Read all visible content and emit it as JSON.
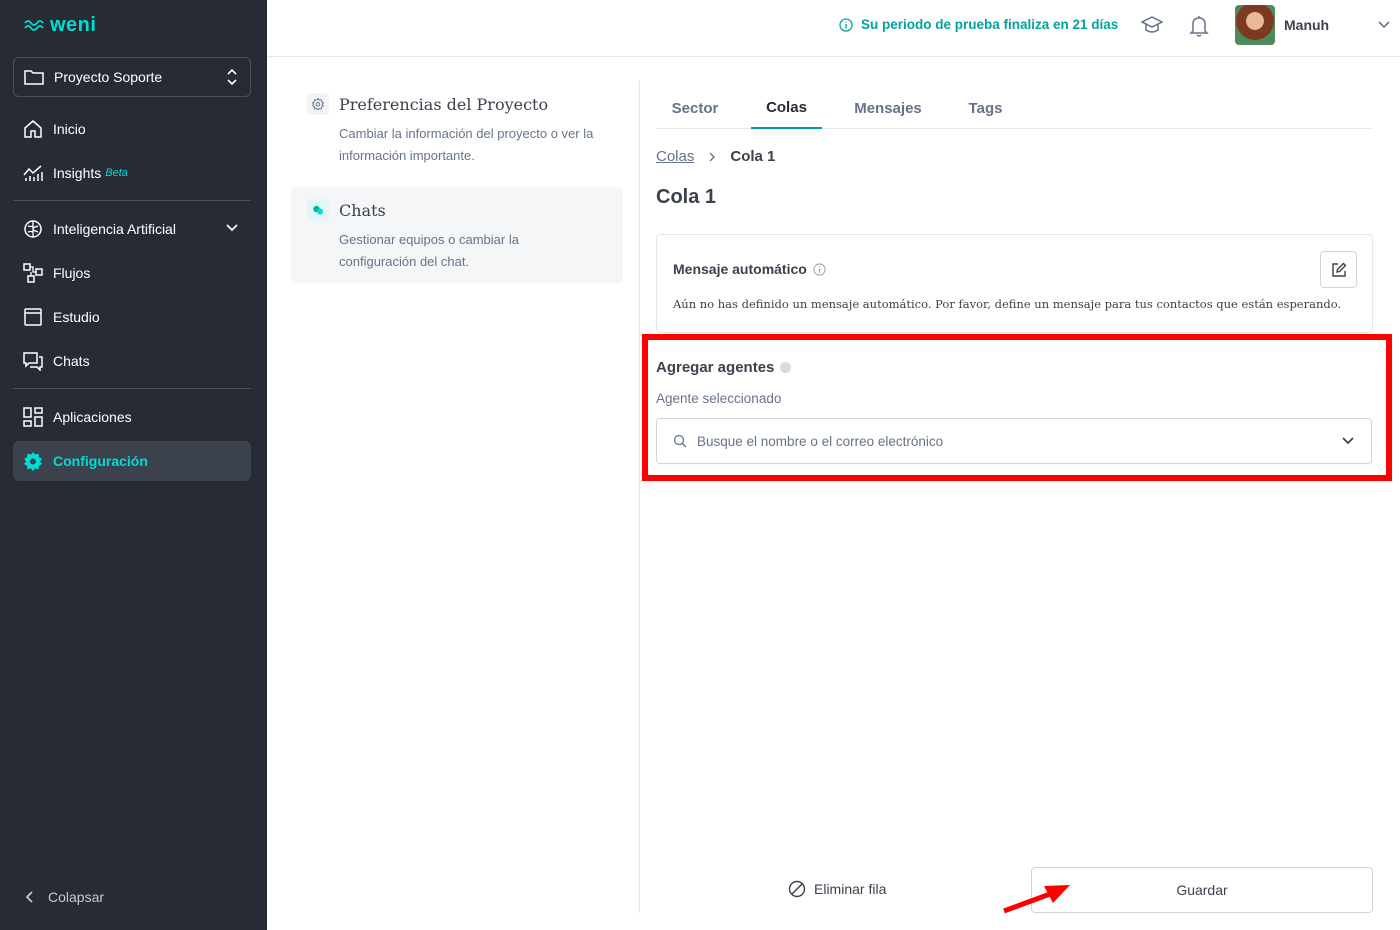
{
  "brand": {
    "name": "weni",
    "accent": "#00ded3"
  },
  "sidebar": {
    "project": "Proyecto Soporte",
    "items": [
      {
        "label": "Inicio",
        "icon": "home-icon"
      },
      {
        "label": "Insights",
        "badge": "Beta",
        "icon": "chart-icon"
      },
      {
        "label": "Inteligencia Artificial",
        "icon": "brain-icon"
      },
      {
        "label": "Flujos",
        "icon": "flows-icon"
      },
      {
        "label": "Estudio",
        "icon": "window-icon"
      },
      {
        "label": "Chats",
        "icon": "chat-icon"
      },
      {
        "label": "Aplicaciones",
        "icon": "apps-icon"
      },
      {
        "label": "Configuración",
        "icon": "gear-icon",
        "active": true
      }
    ],
    "collapse_label": "Colapsar"
  },
  "topbar": {
    "trial_text": "Su periodo de prueba finaliza en 21 días",
    "user_name": "Manuh"
  },
  "settings": {
    "cards": [
      {
        "title": "Preferencias del Proyecto",
        "desc_line1": "Cambiar la información del proyecto o ver la",
        "desc_line2": "información importante."
      },
      {
        "title": "Chats",
        "desc_line1": "Gestionar equipos o cambiar la",
        "desc_line2": "configuración del chat."
      }
    ]
  },
  "main": {
    "tabs": [
      "Sector",
      "Colas",
      "Mensajes",
      "Tags"
    ],
    "active_tab": "Colas",
    "breadcrumb": {
      "parent": "Colas",
      "current": "Cola 1"
    },
    "title": "Cola 1",
    "auto_message": {
      "title": "Mensaje automático",
      "desc": "Aún no has definido un mensaje automático. Por favor, define un mensaje para tus contactos que están esperando."
    },
    "agents": {
      "title": "Agregar agentes",
      "subtitle": "Agente seleccionado",
      "placeholder": "Busque el nombre o el correo electrónico"
    },
    "delete_label": "Eliminar fila",
    "save_label": "Guardar"
  }
}
